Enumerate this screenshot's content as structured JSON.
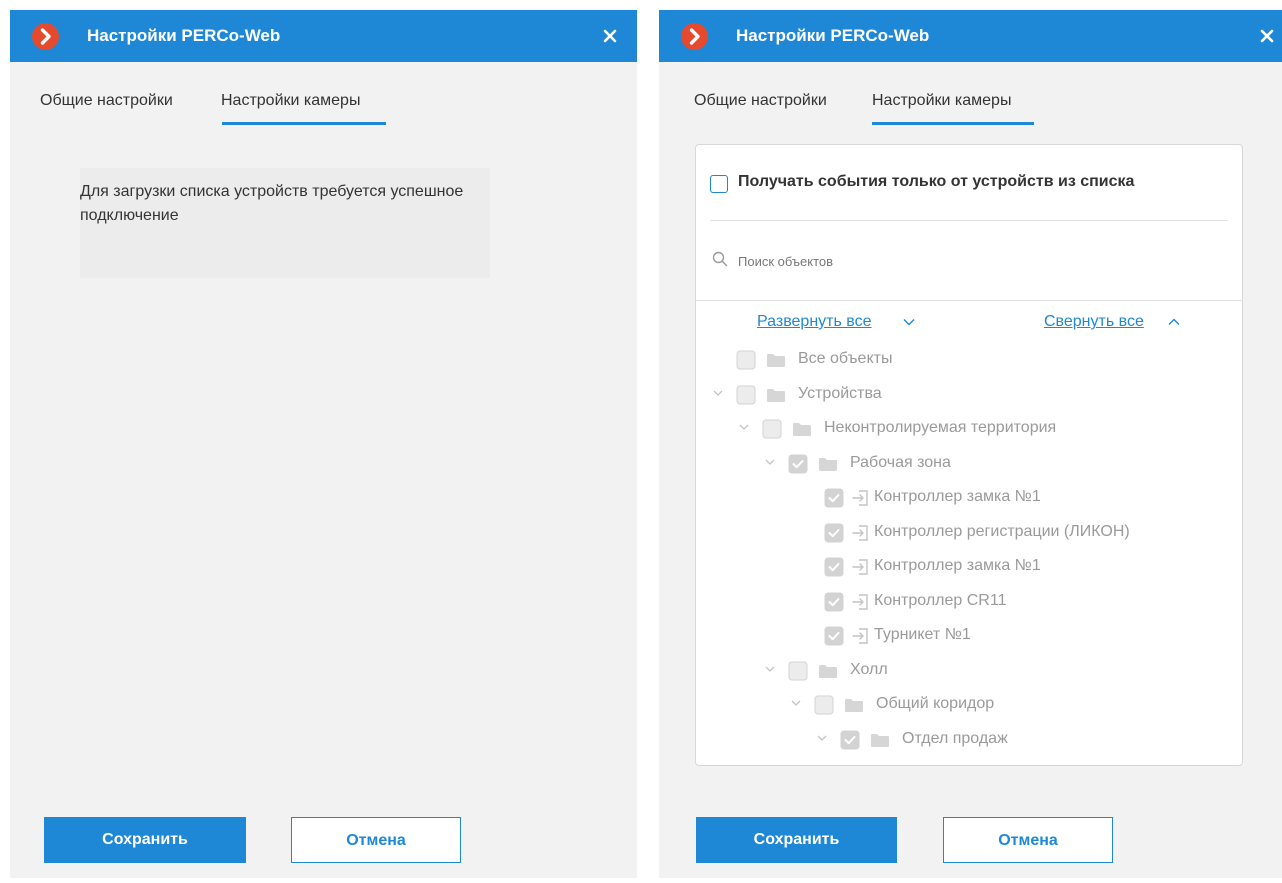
{
  "left_dialog": {
    "title": "Настройки PERCo-Web",
    "tabs": [
      {
        "label": "Общие настройки"
      },
      {
        "label": "Настройки камеры"
      }
    ],
    "message": "Для загрузки списка устройств требуется успешное подключение",
    "buttons": {
      "save": "Сохранить",
      "cancel": "Отмена"
    }
  },
  "right_dialog": {
    "title": "Настройки PERCo-Web",
    "tabs": [
      {
        "label": "Общие настройки"
      },
      {
        "label": "Настройки камеры"
      }
    ],
    "only_list_label": "Получать события только от устройств из списка",
    "only_list_checked": false,
    "search": {
      "placeholder": "Поиск объектов",
      "value": ""
    },
    "expand_all": "Развернуть все",
    "collapse_all": "Свернуть все",
    "tree": [
      {
        "label": "Все объекты",
        "icon": "folder-icon",
        "checked": false,
        "expanded": null
      },
      {
        "label": "Устройства",
        "icon": "folder-icon",
        "checked": false,
        "expanded": true
      },
      {
        "label": "Неконтролируемая территория",
        "icon": "folder-icon",
        "checked": false,
        "expanded": true
      },
      {
        "label": "Рабочая зона",
        "icon": "folder-icon",
        "checked": true,
        "expanded": true
      },
      {
        "label": "Контроллер замка №1",
        "icon": "door-entry-icon",
        "checked": true,
        "expanded": null
      },
      {
        "label": "Контроллер регистрации (ЛИКОН)",
        "icon": "door-entry-icon",
        "checked": true,
        "expanded": null
      },
      {
        "label": "Контроллер замка №1",
        "icon": "door-entry-icon",
        "checked": true,
        "expanded": null
      },
      {
        "label": "Контроллер CR11",
        "icon": "door-entry-icon",
        "checked": true,
        "expanded": null
      },
      {
        "label": "Турникет №1",
        "icon": "door-entry-icon",
        "checked": true,
        "expanded": null
      },
      {
        "label": "Холл",
        "icon": "folder-icon",
        "checked": false,
        "expanded": true
      },
      {
        "label": "Общий коридор",
        "icon": "folder-icon",
        "checked": false,
        "expanded": true
      },
      {
        "label": "Отдел продаж",
        "icon": "folder-icon",
        "checked": true,
        "expanded": true
      }
    ],
    "buttons": {
      "save": "Сохранить",
      "cancel": "Отмена"
    }
  },
  "colors": {
    "accent": "#1e88d6",
    "logo": "#e64a2e",
    "dialog_bg": "#f2f2f2",
    "disabled_text": "#9a9a9a"
  }
}
